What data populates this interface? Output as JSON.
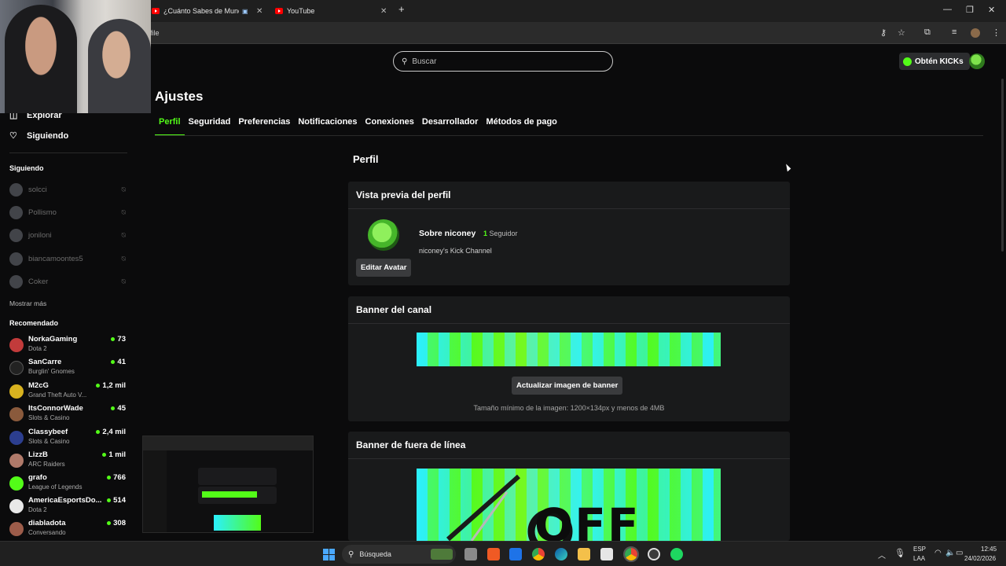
{
  "browser": {
    "tabs": [
      {
        "title": "¿Cuánto Sabes de Mundial?"
      },
      {
        "title": "YouTube"
      }
    ],
    "address": "file"
  },
  "site": {
    "search_placeholder": "Buscar",
    "kicks_label": "Obtén KICKs"
  },
  "sidebar": {
    "nav": [
      {
        "label": "Explorar"
      },
      {
        "label": "Siguiendo"
      }
    ],
    "following_heading": "Siguiendo",
    "following": [
      {
        "name": "solcci"
      },
      {
        "name": "Pollismo"
      },
      {
        "name": "joniloni"
      },
      {
        "name": "biancamoontes5"
      },
      {
        "name": "Coker"
      }
    ],
    "show_more": "Mostrar más",
    "recommended_heading": "Recomendado",
    "recommended": [
      {
        "name": "NorkaGaming",
        "category": "Dota 2",
        "viewers": "73",
        "color": "#c23b3b"
      },
      {
        "name": "SanCarre",
        "category": "Burglin' Gnomes",
        "viewers": "41",
        "color": "#222222"
      },
      {
        "name": "M2cG",
        "category": "Grand Theft Auto V...",
        "viewers": "1,2 mil",
        "color": "#d8b21f"
      },
      {
        "name": "ItsConnorWade",
        "category": "Slots & Casino",
        "viewers": "45",
        "color": "#8a5a3c"
      },
      {
        "name": "Classybeef",
        "category": "Slots & Casino",
        "viewers": "2,4 mil",
        "color": "#2c3e8f"
      },
      {
        "name": "LizzB",
        "category": "ARC Raiders",
        "viewers": "1 mil",
        "color": "#b07a6a"
      },
      {
        "name": "grafo",
        "category": "League of Legends",
        "viewers": "766",
        "color": "#53fc18"
      },
      {
        "name": "AmericaEsportsDo...",
        "category": "Dota 2",
        "viewers": "514",
        "color": "#e8e8e8"
      },
      {
        "name": "diabladota",
        "category": "Conversando",
        "viewers": "308",
        "color": "#9c5c4a"
      }
    ]
  },
  "settings": {
    "title": "Ajustes",
    "tabs": [
      {
        "label": "Perfil"
      },
      {
        "label": "Seguridad"
      },
      {
        "label": "Preferencias"
      },
      {
        "label": "Notificaciones"
      },
      {
        "label": "Conexiones"
      },
      {
        "label": "Desarrollador"
      },
      {
        "label": "Métodos de pago"
      }
    ],
    "section_title": "Perfil",
    "preview": {
      "heading": "Vista previa del perfil",
      "name": "Sobre niconey",
      "followers_count": "1",
      "followers_label": "Seguidor",
      "description": "niconey's Kick Channel",
      "edit_avatar": "Editar Avatar"
    },
    "banner": {
      "heading": "Banner del canal",
      "update_button": "Actualizar imagen de banner",
      "hint": "Tamaño mínimo de la imagen: 1200×134px y menos de 4MB"
    },
    "offline_banner": {
      "heading": "Banner de fuera de línea",
      "art_text": "OFF"
    }
  },
  "taskbar": {
    "search_label": "Búsqueda",
    "lang_1": "ESP",
    "lang_2": "LAA",
    "time": "12:45",
    "date": "24/02/2026"
  },
  "colors": {
    "accent": "#53fc18",
    "background": "#0b0b0c",
    "card": "#191a1b"
  }
}
